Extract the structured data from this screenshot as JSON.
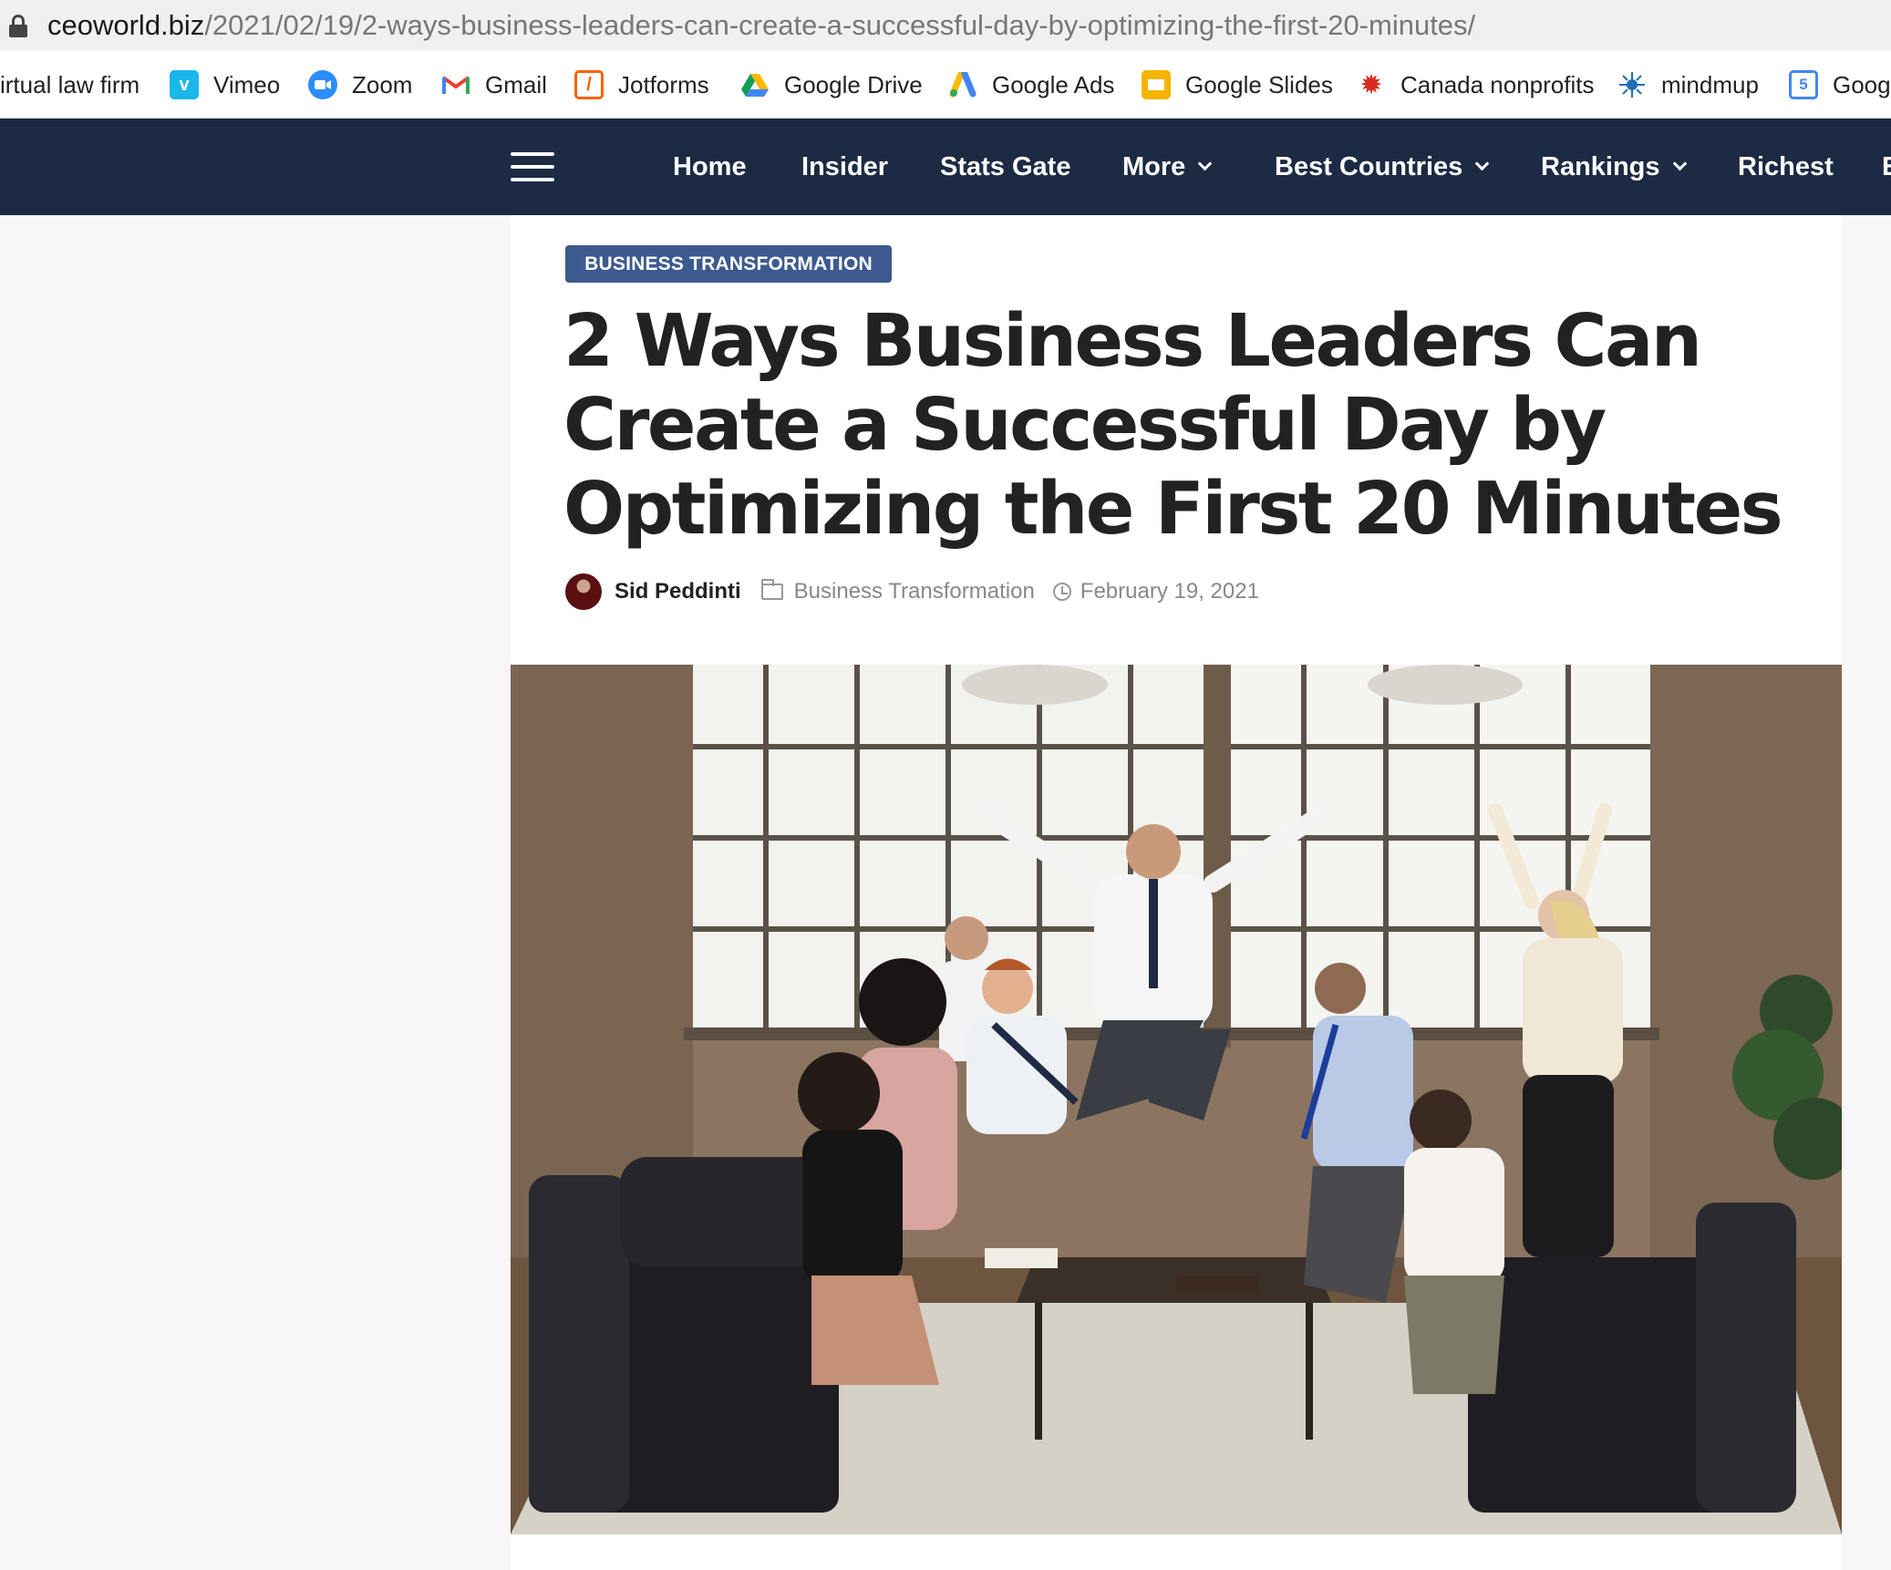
{
  "browser": {
    "url_host": "ceoworld.biz",
    "url_path": "/2021/02/19/2-ways-business-leaders-can-create-a-successful-day-by-optimizing-the-first-20-minutes/"
  },
  "bookmarks": [
    {
      "label": "irtual law firm",
      "icon": "none"
    },
    {
      "label": "Vimeo",
      "icon": "vimeo-icon"
    },
    {
      "label": "Zoom",
      "icon": "zoom-icon"
    },
    {
      "label": "Gmail",
      "icon": "gmail-icon"
    },
    {
      "label": "Jotforms",
      "icon": "jotform-icon"
    },
    {
      "label": "Google Drive",
      "icon": "google-drive-icon"
    },
    {
      "label": "Google Ads",
      "icon": "google-ads-icon"
    },
    {
      "label": "Google Slides",
      "icon": "google-slides-icon"
    },
    {
      "label": "Canada nonprofits",
      "icon": "maple-leaf-icon"
    },
    {
      "label": "mindmup",
      "icon": "mindmup-icon"
    },
    {
      "label": "Googl",
      "icon": "google-calendar-icon"
    }
  ],
  "nav": {
    "items": [
      {
        "label": "Home"
      },
      {
        "label": "Insider"
      },
      {
        "label": "Stats Gate"
      },
      {
        "label": "More"
      },
      {
        "label": "Best Countries"
      },
      {
        "label": "Rankings"
      },
      {
        "label": "Richest"
      },
      {
        "label": "E"
      }
    ]
  },
  "article": {
    "category_badge": "BUSINESS TRANSFORMATION",
    "title": "2 Ways Business Leaders Can Create a Successful Day by Optimizing the First 20 Minutes",
    "author": "Sid Peddinti",
    "category": "Business Transformation",
    "date": "February 19, 2021"
  },
  "colors": {
    "nav_bg": "#1c2a44",
    "badge_bg": "#3d5a8f",
    "title_text": "#222222"
  }
}
